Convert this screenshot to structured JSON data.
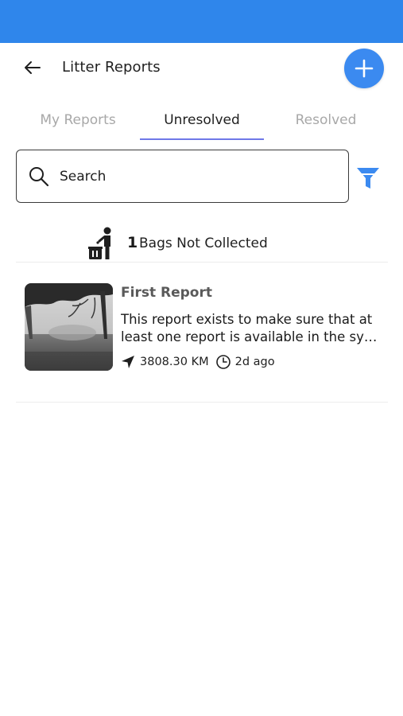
{
  "app_bar": {
    "title": "Litter Reports",
    "back_icon": "arrow-left-icon",
    "add_icon": "plus-icon",
    "accent": "#3b8af0"
  },
  "status_bar": {
    "color": "#2f86eb"
  },
  "tabs": [
    {
      "label": "My Reports",
      "active": false
    },
    {
      "label": "Unresolved",
      "active": true
    },
    {
      "label": "Resolved",
      "active": false
    }
  ],
  "search": {
    "placeholder": "Search",
    "icon": "search-icon",
    "filter_icon": "filter-icon"
  },
  "summary": {
    "count": "1",
    "label": "Bags Not Collected",
    "icon": "trash-bin-person-icon"
  },
  "reports": [
    {
      "title": "First Report",
      "description_line1": "This report exists to make sure that at",
      "description_line2": "least one report is available in the sy…",
      "distance": "3808.30 KM",
      "time_ago": "2d ago"
    }
  ]
}
